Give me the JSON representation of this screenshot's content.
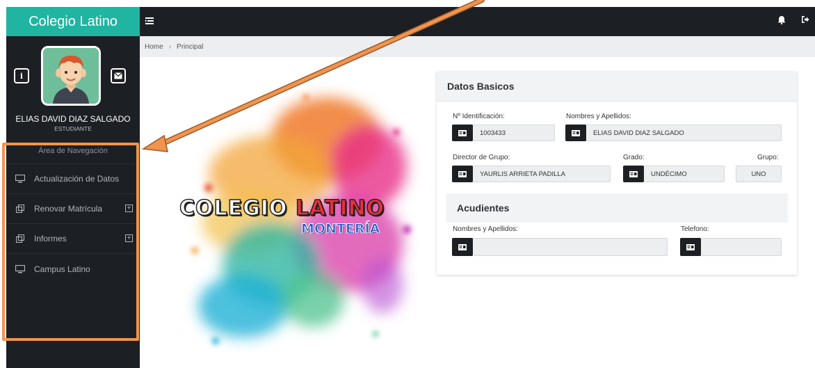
{
  "sidebar": {
    "brand": "Colegio Latino",
    "user_name": "ELIAS DAVID DIAZ SALGADO",
    "user_role": "ESTUDIANTE",
    "nav_title": "Área de Navegación",
    "items": [
      {
        "label": "Actualización de Datos",
        "icon": "monitor-icon",
        "expandable": false
      },
      {
        "label": "Renovar Matrícula",
        "icon": "copy-icon",
        "expandable": true
      },
      {
        "label": "Informes",
        "icon": "copy-icon",
        "expandable": true
      },
      {
        "label": "Campus Latino",
        "icon": "monitor-icon",
        "expandable": false
      }
    ]
  },
  "topbar": {
    "icons": [
      "menu-toggle-icon",
      "bell-icon",
      "logout-icon"
    ]
  },
  "breadcrumb": {
    "home": "Home",
    "current": "Principal"
  },
  "splash": {
    "logo_word1": "COLEGIO",
    "logo_word2": "LATINO",
    "logo_sub": "MONTERÍA"
  },
  "datos_basicos": {
    "title": "Datos Basicos",
    "id_label": "Nº Identificación:",
    "id_value": "1003433",
    "name_label": "Nombres y Apellidos:",
    "name_value": "ELIAS DAVID DIAZ SALGADO",
    "director_label": "Director de Grupo:",
    "director_value": "YAURLIS ARRIETA PADILLA",
    "grado_label": "Grado:",
    "grado_value": "UNDÉCIMO",
    "grupo_label": "Grupo:",
    "grupo_value": "UNO"
  },
  "acudientes": {
    "title": "Acudientes",
    "name_label": "Nombres y Apellidos:",
    "name_value": "",
    "phone_label": "Telefono:",
    "phone_value": ""
  },
  "colors": {
    "brand": "#1fb5a0",
    "dark": "#1c1f24",
    "highlight": "#f0944f"
  }
}
